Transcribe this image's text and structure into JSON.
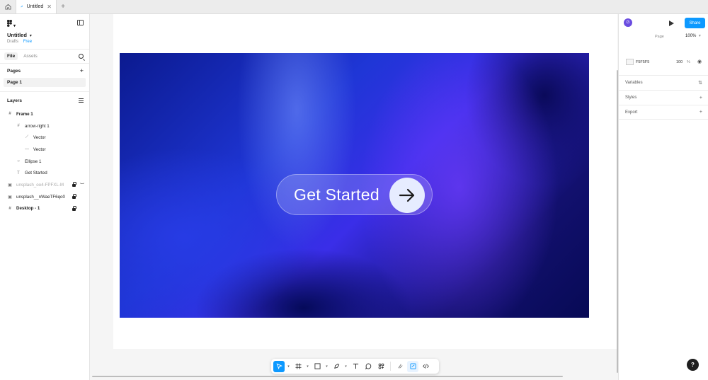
{
  "tabs": [
    {
      "label": "Untitled"
    }
  ],
  "file": {
    "title": "Untitled",
    "location": "Drafts",
    "plan": "Free"
  },
  "sidebar": {
    "tabs": [
      "File",
      "Assets"
    ],
    "pages_heading": "Pages",
    "pages": [
      "Page 1"
    ],
    "layers_heading": "Layers",
    "layers": [
      {
        "name": "Frame 1",
        "icon": "frame-icon",
        "bold": true
      },
      {
        "name": "arrow-right 1",
        "icon": "frame-icon"
      },
      {
        "name": "Vector",
        "icon": "vector-icon"
      },
      {
        "name": "Vector",
        "icon": "vector-icon"
      },
      {
        "name": "Ellipse 1",
        "icon": "ellipse-icon"
      },
      {
        "name": "Get Started",
        "icon": "text-icon"
      },
      {
        "name": "unsplash_oo4-FPFXL-M",
        "icon": "image-icon",
        "locked": true,
        "hidden": true
      },
      {
        "name": "unsplash__nWaeTF6qo0",
        "icon": "image-icon",
        "locked": true
      },
      {
        "name": "Desktop - 1",
        "icon": "frame-icon",
        "bold": true,
        "locked": true
      }
    ]
  },
  "canvas": {
    "button_label": "Get Started",
    "button_icon": "arrow-right-icon"
  },
  "toolbar": {
    "tools": [
      "move-tool",
      "frame-tool",
      "shape-tool",
      "pen-tool",
      "text-tool",
      "comment-tool",
      "actions-tool",
      "ui3-tool",
      "dev-mode-tool",
      "code-tool"
    ]
  },
  "right_panel": {
    "share_label": "Share",
    "zoom": "100%",
    "page_label": "Page",
    "bg_hex": "F5F5F5",
    "bg_opacity": "100",
    "sections": [
      "Variables",
      "Styles",
      "Export"
    ]
  },
  "colors": {
    "accent": "#0d99ff",
    "canvas_bg": "#f5f5f5"
  }
}
